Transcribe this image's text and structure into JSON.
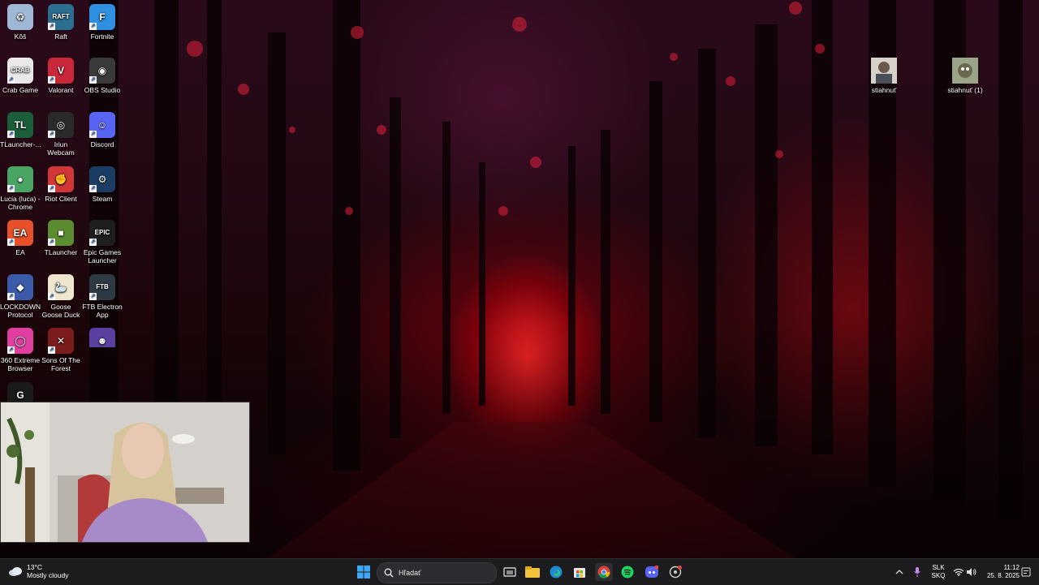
{
  "desktop": {
    "icons": [
      {
        "label": "Kôš",
        "icon": "recycle-bin-icon",
        "color": "#9fb8d6"
      },
      {
        "label": "Raft",
        "icon": "raft-icon",
        "color": "#2c6e8f"
      },
      {
        "label": "Fortnite",
        "icon": "fortnite-icon",
        "color": "#2f8fe0"
      },
      {
        "label": "Crab Game",
        "icon": "crab-game-icon",
        "color": "#e9e9e9"
      },
      {
        "label": "Valorant",
        "icon": "valorant-icon",
        "color": "#c8283a"
      },
      {
        "label": "OBS Studio",
        "icon": "obs-icon",
        "color": "#3a3a3a"
      },
      {
        "label": "TLauncher-...",
        "icon": "tlauncher-installer-icon",
        "color": "#1b5e3a"
      },
      {
        "label": "Iriun Webcam",
        "icon": "iriun-webcam-icon",
        "color": "#2a2a2a"
      },
      {
        "label": "Discord",
        "icon": "discord-icon",
        "color": "#5865f2"
      },
      {
        "label": "Lucia (luca) - Chrome",
        "icon": "chrome-profile-icon",
        "color": "#4aa564"
      },
      {
        "label": "Riot Client",
        "icon": "riot-client-icon",
        "color": "#d13639"
      },
      {
        "label": "Steam",
        "icon": "steam-icon",
        "color": "#1b3d63"
      },
      {
        "label": "EA",
        "icon": "ea-icon",
        "color": "#e8502a"
      },
      {
        "label": "TLauncher",
        "icon": "tlauncher-icon",
        "color": "#5b8c2f"
      },
      {
        "label": "Epic Games Launcher",
        "icon": "epic-games-icon",
        "color": "#1e1e1e"
      },
      {
        "label": "LOCKDOWN Protocol",
        "icon": "lockdown-protocol-icon",
        "color": "#3b5ba8"
      },
      {
        "label": "Goose Goose Duck",
        "icon": "goose-goose-duck-icon",
        "color": "#efe6d0"
      },
      {
        "label": "FTB Electron App",
        "icon": "ftb-icon",
        "color": "#2d3a44"
      },
      {
        "label": "360 Extreme Browser",
        "icon": "360-browser-icon",
        "color": "#e03fa0"
      },
      {
        "label": "Sons Of The Forest",
        "icon": "sons-of-the-forest-icon",
        "color": "#7a1c1c"
      },
      {
        "label": "",
        "icon": "emoji-app-icon",
        "color": "#5a3fa0"
      },
      {
        "label": "",
        "icon": "logitech-g-icon",
        "color": "#1a1a1a"
      }
    ],
    "files": [
      {
        "label": "stiahnuť",
        "icon": "image-file-icon"
      },
      {
        "label": "stiahnuť (1)",
        "icon": "image-file-icon"
      }
    ]
  },
  "taskbar": {
    "weather": {
      "temp": "13°C",
      "desc": "Mostly cloudy"
    },
    "search_placeholder": "Hľadať",
    "apps": [
      "start-icon",
      "task-view-icon",
      "file-explorer-icon",
      "edge-icon",
      "store-icon",
      "chrome-icon",
      "spotify-icon",
      "discord-icon",
      "steam-helper-icon"
    ],
    "language": {
      "line1": "SLK",
      "line2": "SKQ"
    },
    "clock": {
      "time": "11:12",
      "date": "25. 8. 2025"
    }
  }
}
